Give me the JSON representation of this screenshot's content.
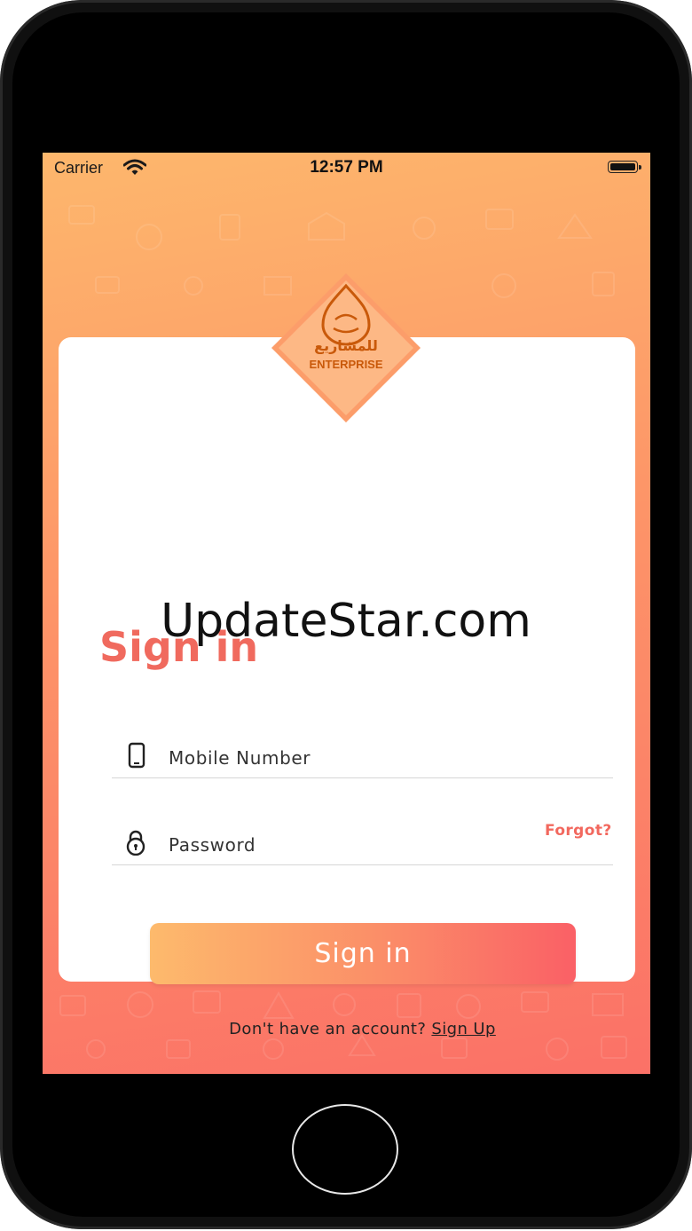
{
  "status_bar": {
    "carrier": "Carrier",
    "time": "12:57 PM"
  },
  "logo": {
    "text": "ENTERPRISE",
    "arabic_text": "للمشاريع"
  },
  "signin": {
    "title": "Sign in",
    "mobile_placeholder": "Mobile Number",
    "password_placeholder": "Password",
    "forgot_label": "Forgot?",
    "button_label": "Sign in",
    "no_account_text": "Don't have an account?",
    "signup_link": "Sign Up"
  },
  "watermark": "UpdateStar.com",
  "colors": {
    "accent": "#f06a5e",
    "gradient_start": "#fdba6c",
    "gradient_end": "#fa6066"
  },
  "icons": {
    "mobile": "phone-icon",
    "password": "lock-icon",
    "wifi": "wifi-icon",
    "battery": "battery-icon"
  }
}
